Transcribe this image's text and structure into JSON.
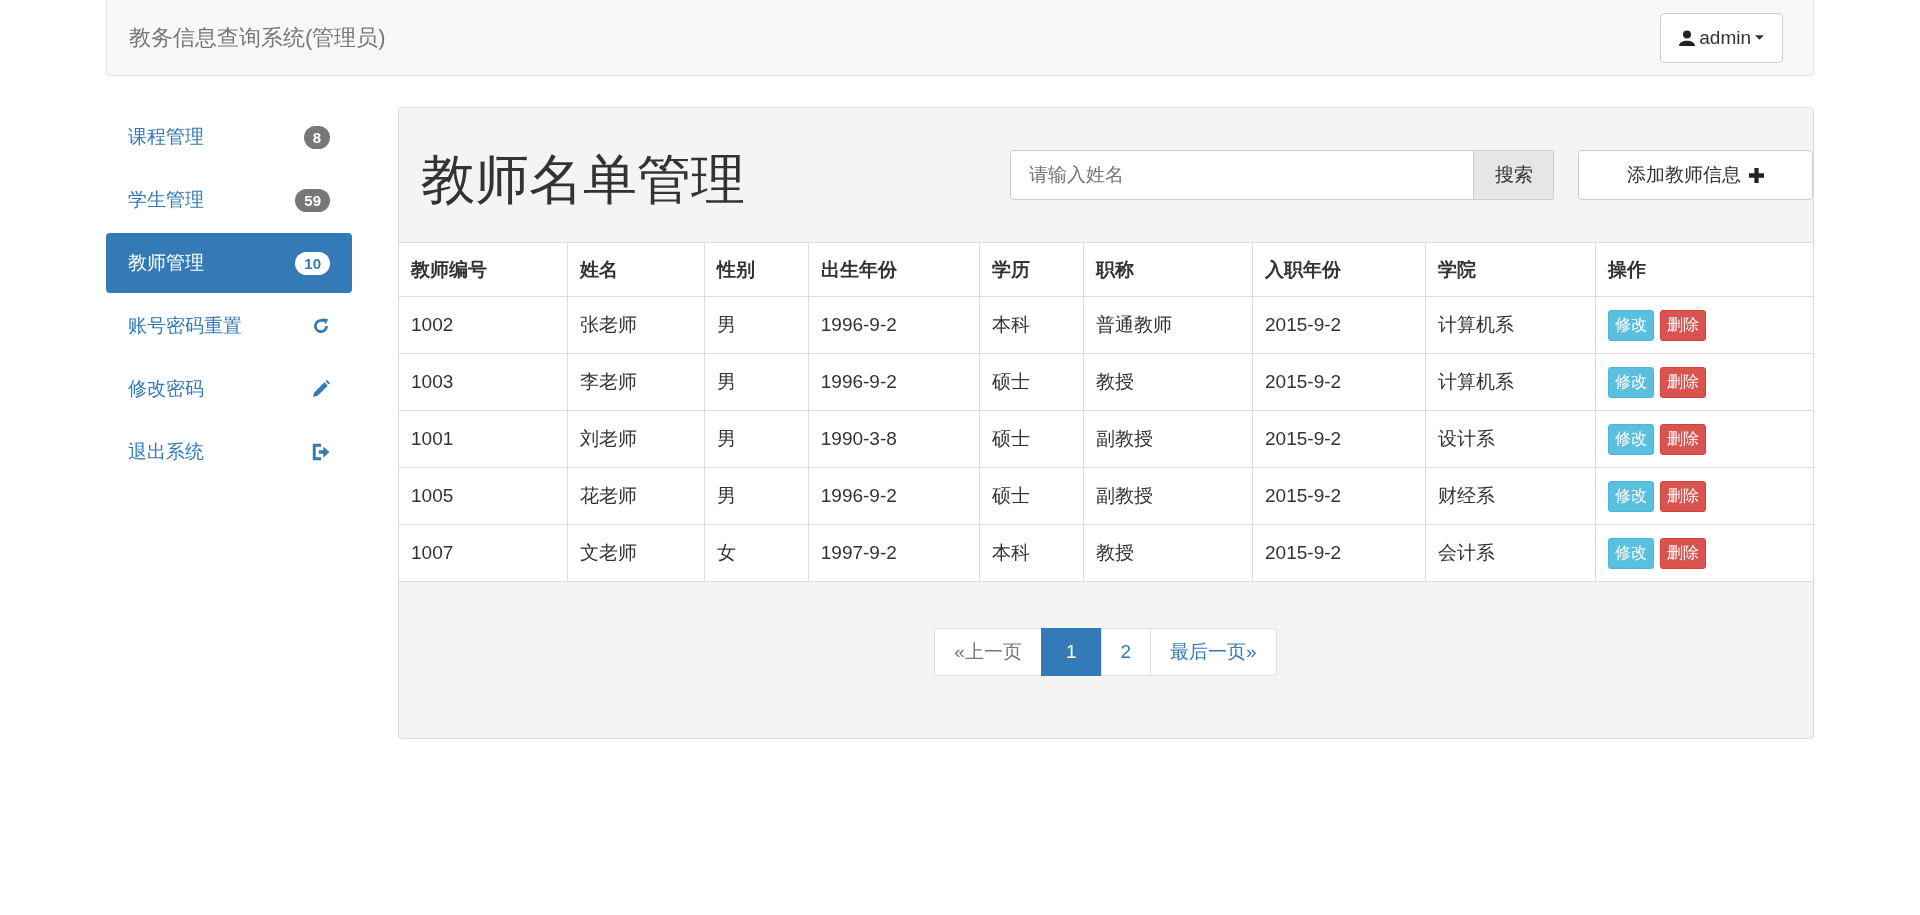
{
  "navbar": {
    "brand": "教务信息查询系统(管理员)",
    "user": "admin"
  },
  "sidebar": {
    "items": [
      {
        "label": "课程管理",
        "kind": "badge",
        "badge": "8",
        "selected": false
      },
      {
        "label": "学生管理",
        "kind": "badge",
        "badge": "59",
        "selected": false
      },
      {
        "label": "教师管理",
        "kind": "badge",
        "badge": "10",
        "selected": true
      },
      {
        "label": "账号密码重置",
        "kind": "refresh",
        "selected": false
      },
      {
        "label": "修改密码",
        "kind": "edit",
        "selected": false
      },
      {
        "label": "退出系统",
        "kind": "logout",
        "selected": false
      }
    ]
  },
  "panel": {
    "title": "教师名单管理",
    "search": {
      "placeholder": "请输入姓名",
      "button": "搜索"
    },
    "add_button": "添加教师信息"
  },
  "table": {
    "columns": [
      "教师编号",
      "姓名",
      "性别",
      "出生年份",
      "学历",
      "职称",
      "入职年份",
      "学院",
      "操作"
    ],
    "rows": [
      {
        "cells": [
          "1002",
          "张老师",
          "男",
          "1996-9-2",
          "本科",
          "普通教师",
          "2015-9-2",
          "计算机系"
        ],
        "actions": [
          "修改",
          "删除"
        ]
      },
      {
        "cells": [
          "1003",
          "李老师",
          "男",
          "1996-9-2",
          "硕士",
          "教授",
          "2015-9-2",
          "计算机系"
        ],
        "actions": [
          "修改",
          "删除"
        ]
      },
      {
        "cells": [
          "1001",
          "刘老师",
          "男",
          "1990-3-8",
          "硕士",
          "副教授",
          "2015-9-2",
          "设计系"
        ],
        "actions": [
          "修改",
          "删除"
        ]
      },
      {
        "cells": [
          "1005",
          "花老师",
          "男",
          "1996-9-2",
          "硕士",
          "副教授",
          "2015-9-2",
          "财经系"
        ],
        "actions": [
          "修改",
          "删除"
        ]
      },
      {
        "cells": [
          "1007",
          "文老师",
          "女",
          "1997-9-2",
          "本科",
          "教授",
          "2015-9-2",
          "会计系"
        ],
        "actions": [
          "修改",
          "删除"
        ]
      }
    ]
  },
  "pagination": [
    {
      "label": "«上一页",
      "disabled": true,
      "selected": false
    },
    {
      "label": "1",
      "disabled": false,
      "selected": true
    },
    {
      "label": "2",
      "disabled": false,
      "selected": false
    },
    {
      "label": "最后一页»",
      "disabled": false,
      "selected": false
    }
  ]
}
